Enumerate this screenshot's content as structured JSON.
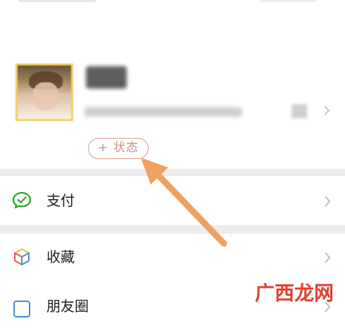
{
  "profile": {
    "status_label": "+ 状态"
  },
  "menu": {
    "items": [
      {
        "label": "支付"
      },
      {
        "label": "收藏"
      },
      {
        "label": "朋友圈"
      }
    ]
  },
  "watermark": {
    "text": "广西龙网"
  },
  "colors": {
    "status_border": "#d79a8a",
    "annotation_arrow": "#f0a060",
    "pay_icon": "#1aad19",
    "watermark": "#e0402e"
  }
}
